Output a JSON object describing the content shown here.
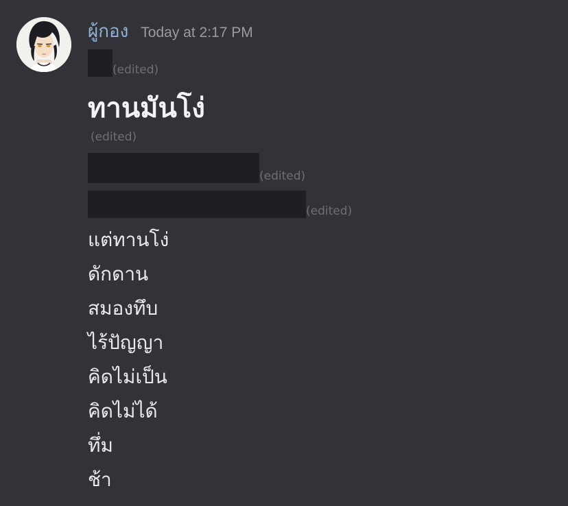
{
  "message": {
    "author": "ผู้กอง",
    "timestamp": "Today at 2:17 PM",
    "edited_label": "(edited)",
    "big_line": "ทานมันโง่",
    "lines": [
      "แต่ทานโง่",
      "ดักดาน",
      "สมองทึบ",
      "ไร้ปัญญา",
      "คิดไม่เป็น",
      "คิดไม่ได้",
      "ทึ่ม",
      "ช้า"
    ]
  },
  "colors": {
    "background": "#313338",
    "username": "#94b2d6",
    "timestamp": "#9a9ca3",
    "edited": "#6d6f76",
    "redaction": "#1e1f22",
    "text": "#e9eaec"
  },
  "icons": {
    "avatar": "user-avatar-anime-portrait"
  }
}
